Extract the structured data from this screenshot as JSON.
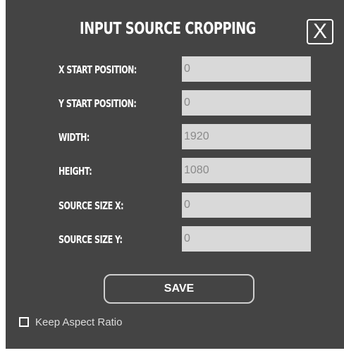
{
  "dialog": {
    "title": "INPUT SOURCE CROPPING",
    "close_label": "X",
    "fields": [
      {
        "label": "X START POSITION:",
        "value": "0"
      },
      {
        "label": "Y START POSITION:",
        "value": "0"
      },
      {
        "label": "WIDTH:",
        "value": "1920"
      },
      {
        "label": "HEIGHT:",
        "value": "1080"
      },
      {
        "label": "SOURCE SIZE X:",
        "value": "0"
      },
      {
        "label": "SOURCE SIZE Y:",
        "value": "0"
      }
    ],
    "save_label": "SAVE",
    "keep_aspect_ratio": {
      "label": "Keep Aspect Ratio",
      "checked": false
    }
  },
  "colors": {
    "panel_background": "#444444",
    "field_background": "#d9d9d9",
    "field_text": "#8a8a8a",
    "label_text": "#ffffff"
  }
}
